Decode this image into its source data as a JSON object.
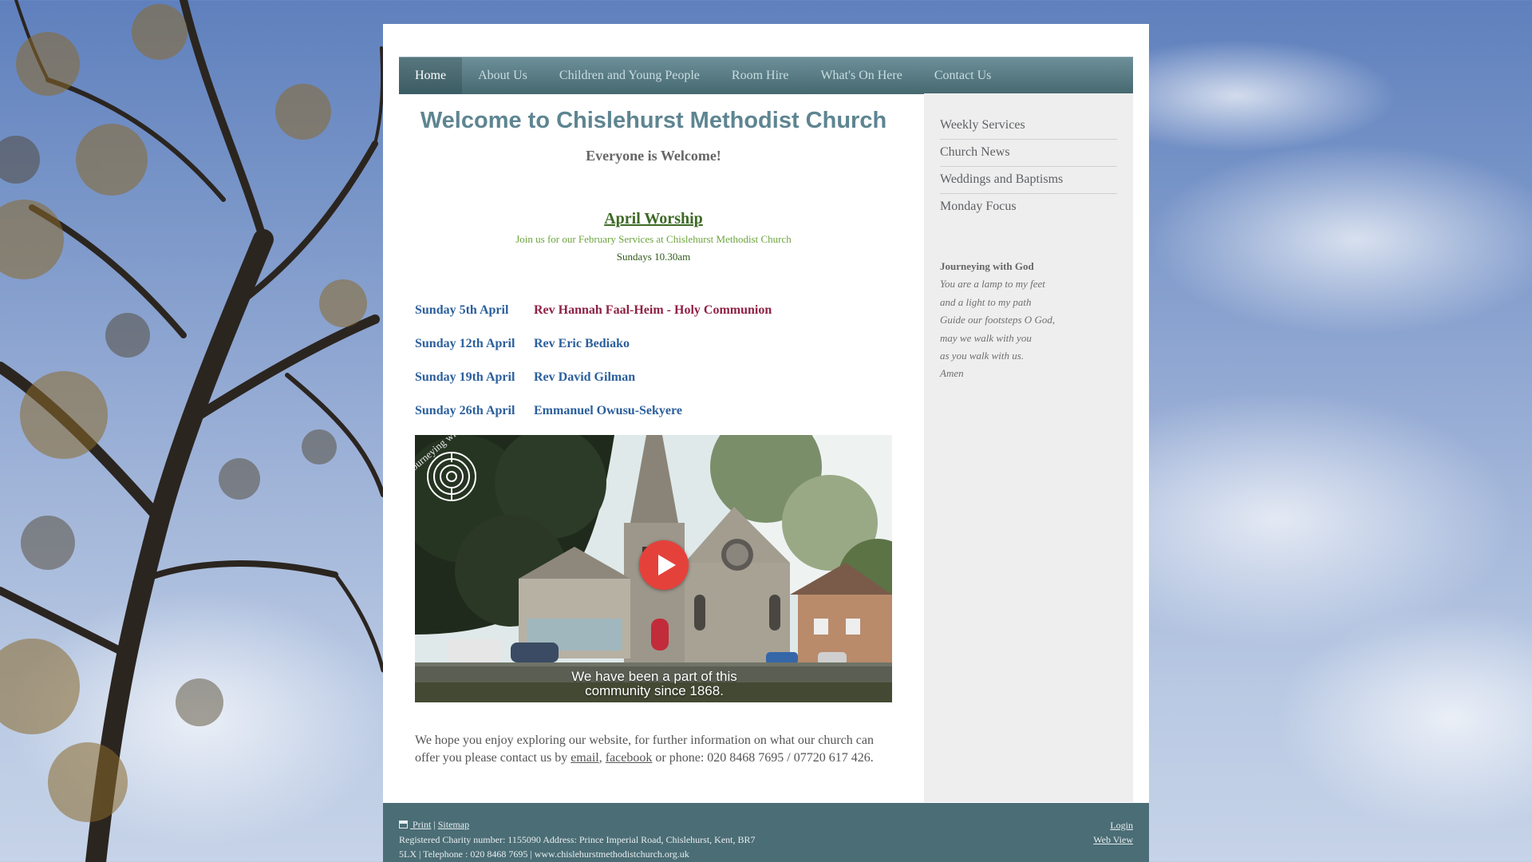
{
  "nav": {
    "items": [
      {
        "label": "Home",
        "active": true
      },
      {
        "label": "About Us",
        "active": false
      },
      {
        "label": "Children and Young People",
        "active": false
      },
      {
        "label": "Room Hire",
        "active": false
      },
      {
        "label": "What's On Here",
        "active": false
      },
      {
        "label": "Contact Us",
        "active": false
      }
    ]
  },
  "main": {
    "title": "Welcome to Chislehurst Methodist Church",
    "subtitle": "Everyone is Welcome!",
    "worship_heading": "April Worship",
    "join_text": "Join us for our February Services at Chislehurst Methodist Church",
    "sundays_time": "Sundays 10.30am",
    "services": [
      {
        "date": "Sunday 5th April",
        "minister": "Rev Hannah Faal-Heim - Holy Communion"
      },
      {
        "date": "Sunday 12th April",
        "minister": "Rev Eric Bediako"
      },
      {
        "date": "Sunday 19th April",
        "minister": "Rev David Gilman"
      },
      {
        "date": "Sunday 26th April",
        "minister": "Emmanuel Owusu-Sekyere"
      }
    ],
    "video": {
      "badge_text": "Journeying with God",
      "caption_line1": "We have been a part of this",
      "caption_line2": "community since 1868."
    },
    "intro": {
      "before": "We hope you enjoy exploring our website, for further information on what our church can offer you please contact us by ",
      "email_link": "email",
      "separator": ", ",
      "facebook_link": "facebook",
      "after": " or phone: 020 8468 7695 / 07720 617 426."
    }
  },
  "sidebar": {
    "links": [
      "Weekly Services",
      "Church News",
      "Weddings and Baptisms",
      "Monday Focus"
    ],
    "prayer": {
      "title": "Journeying with God",
      "lines": [
        "You are a lamp to my feet",
        "and a light to my path",
        "Guide our footsteps O God,",
        "may we walk with you",
        "as you walk with us.",
        "Amen"
      ]
    }
  },
  "footer": {
    "print_label": "Print",
    "pipe": "|",
    "sitemap_label": "Sitemap",
    "line1": "Registered Charity number: 1155090 Address: Prince Imperial Road, Chislehurst, Kent, BR7",
    "line2": "5LX | Telephone : 020 8468 7695 | www.chislehurstmethodistchurch.org.uk",
    "login_label": "Login",
    "webview_label": "Web View"
  },
  "colors": {
    "nav_bg": "#4f727a",
    "title": "#5e8591",
    "worship_green": "#3d6a25",
    "service_blue": "#2b5f9c",
    "service_highlight": "#8e2244",
    "footer_bg": "#4b6d75",
    "play_red": "#e5413b"
  },
  "icons": {
    "print": "print-icon",
    "play": "play-icon",
    "badge": "labyrinth-logo-icon"
  }
}
